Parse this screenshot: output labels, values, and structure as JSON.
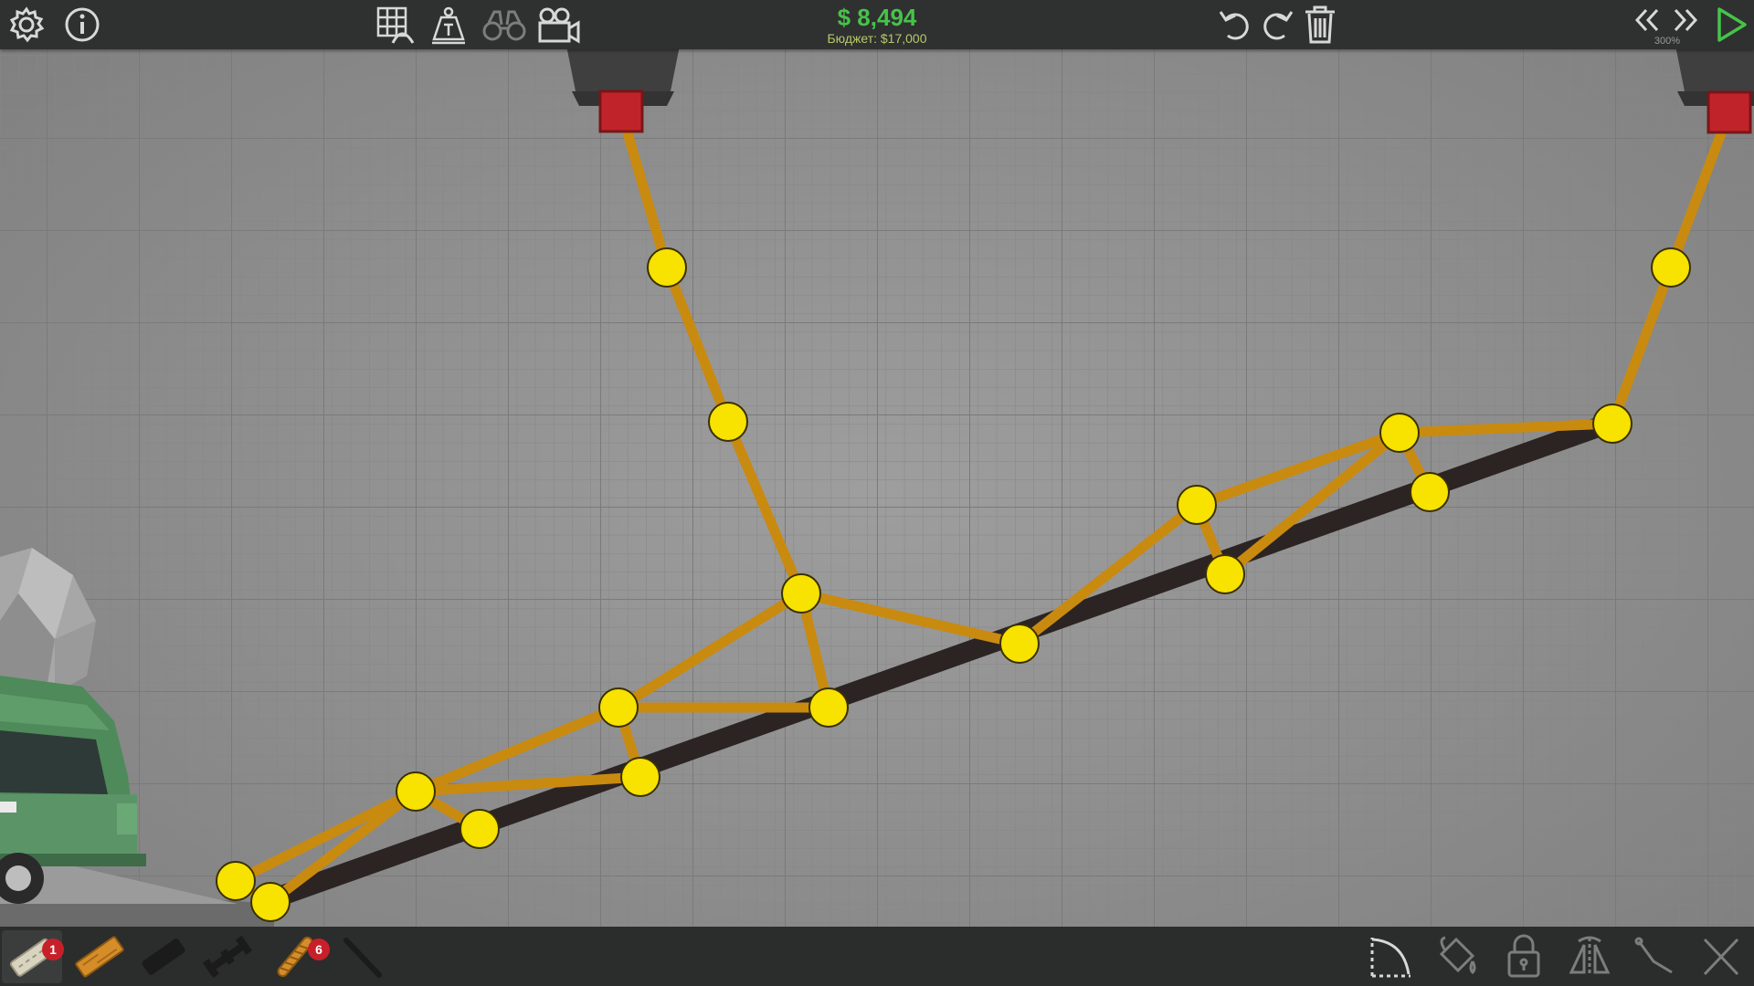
{
  "header": {
    "money": "$ 8,494",
    "budget": "Бюджет: $17,000",
    "speed": "300%"
  },
  "icons": {
    "settings": "gear-icon",
    "info": "info-icon",
    "grid": "grid-bridge-icon",
    "weight": "weight-icon",
    "binoculars": "binoculars-icon",
    "camera": "camera-icon",
    "undo": "undo-icon",
    "redo": "redo-icon",
    "trash": "trash-icon",
    "rewind": "rewind-icon",
    "fast-forward": "fast-forward-icon",
    "play": "play-icon"
  },
  "materials": [
    {
      "name": "road",
      "count": "1"
    },
    {
      "name": "wood",
      "count": ""
    },
    {
      "name": "reinforced-road",
      "count": ""
    },
    {
      "name": "steel",
      "count": ""
    },
    {
      "name": "hydraulic-rope",
      "count": "6"
    },
    {
      "name": "cable",
      "count": ""
    }
  ],
  "colors": {
    "background": "#8f8f8f",
    "toolbar": "#2f3030",
    "money": "#47c24a",
    "beam": "#c98a10",
    "joint": "#f7e200",
    "anchor": "#c0242a",
    "road": "#2b2423",
    "truck": "#4e8a5a"
  }
}
